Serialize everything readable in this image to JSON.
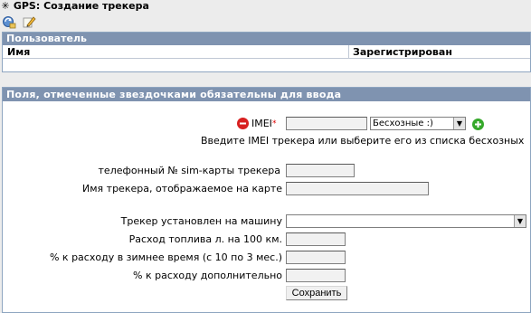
{
  "window": {
    "title": "GPS: Создание трекера",
    "title_icon": "✳"
  },
  "toolbar": {
    "icons": [
      "refresh-icon",
      "edit-icon"
    ]
  },
  "user_panel": {
    "header": "Пользователь",
    "columns": [
      "Имя",
      "Зарегистрирован"
    ]
  },
  "form": {
    "header": "Поля, отмеченные звездочками обязательны для ввода",
    "imei": {
      "label": "IMEI",
      "required_mark": "*",
      "value": "",
      "select_value": "Бесхозные :)",
      "hint": "Введите IMEI трекера или выберите его из списка бесхозных"
    },
    "sim_label": "телефонный № sim-карты трекера",
    "name_label": "Имя трекера, отображаемое на карте",
    "car_label": "Трекер установлен на машину",
    "car_value": "",
    "fuel_label": "Расход топлива л. на 100 км.",
    "winter_label": "% к расходу в зимнее время (с 10 по 3 мес.)",
    "extra_label": "% к расходу дополнительно",
    "save_label": "Сохранить"
  },
  "colors": {
    "panel_header": "#7f93b0",
    "page_bg": "#ececec",
    "remove_icon": "#d82020",
    "add_icon": "#35a82a"
  }
}
